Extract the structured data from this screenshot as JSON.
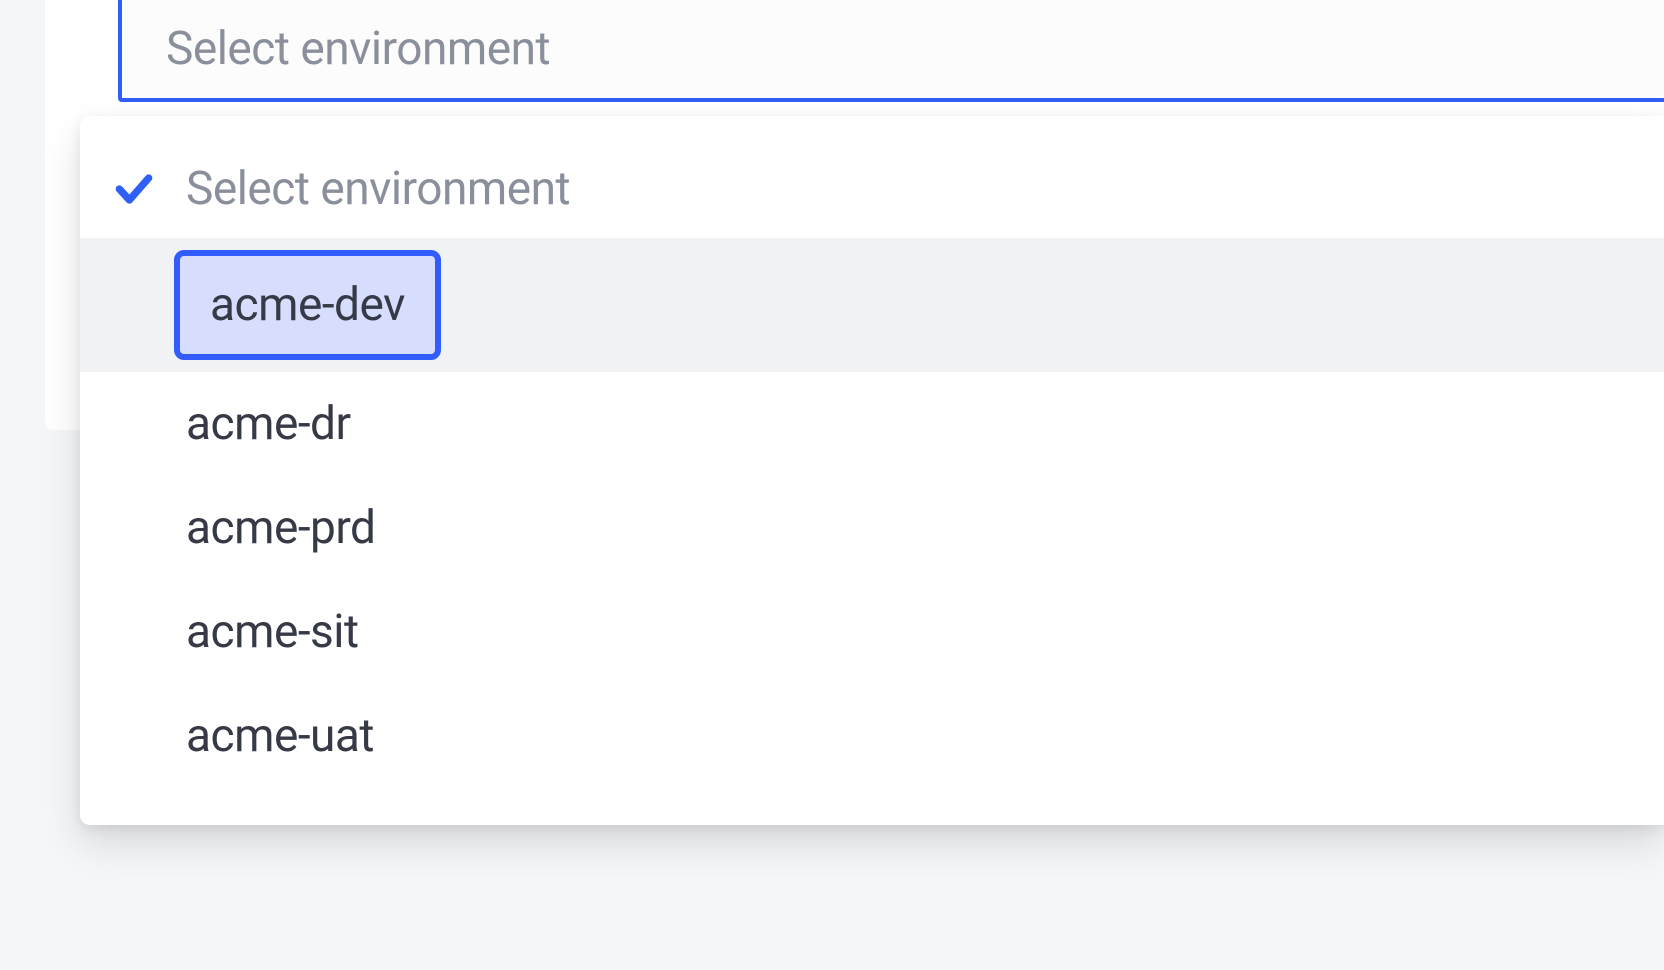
{
  "select": {
    "placeholder": "Select environment"
  },
  "dropdown": {
    "items": [
      {
        "label": "Select environment",
        "selected": true,
        "muted": true,
        "hovered": false,
        "highlighted": false
      },
      {
        "label": "acme-dev",
        "selected": false,
        "muted": false,
        "hovered": true,
        "highlighted": true
      },
      {
        "label": "acme-dr",
        "selected": false,
        "muted": false,
        "hovered": false,
        "highlighted": false
      },
      {
        "label": "acme-prd",
        "selected": false,
        "muted": false,
        "hovered": false,
        "highlighted": false
      },
      {
        "label": "acme-sit",
        "selected": false,
        "muted": false,
        "hovered": false,
        "highlighted": false
      },
      {
        "label": "acme-uat",
        "selected": false,
        "muted": false,
        "hovered": false,
        "highlighted": false
      }
    ]
  }
}
